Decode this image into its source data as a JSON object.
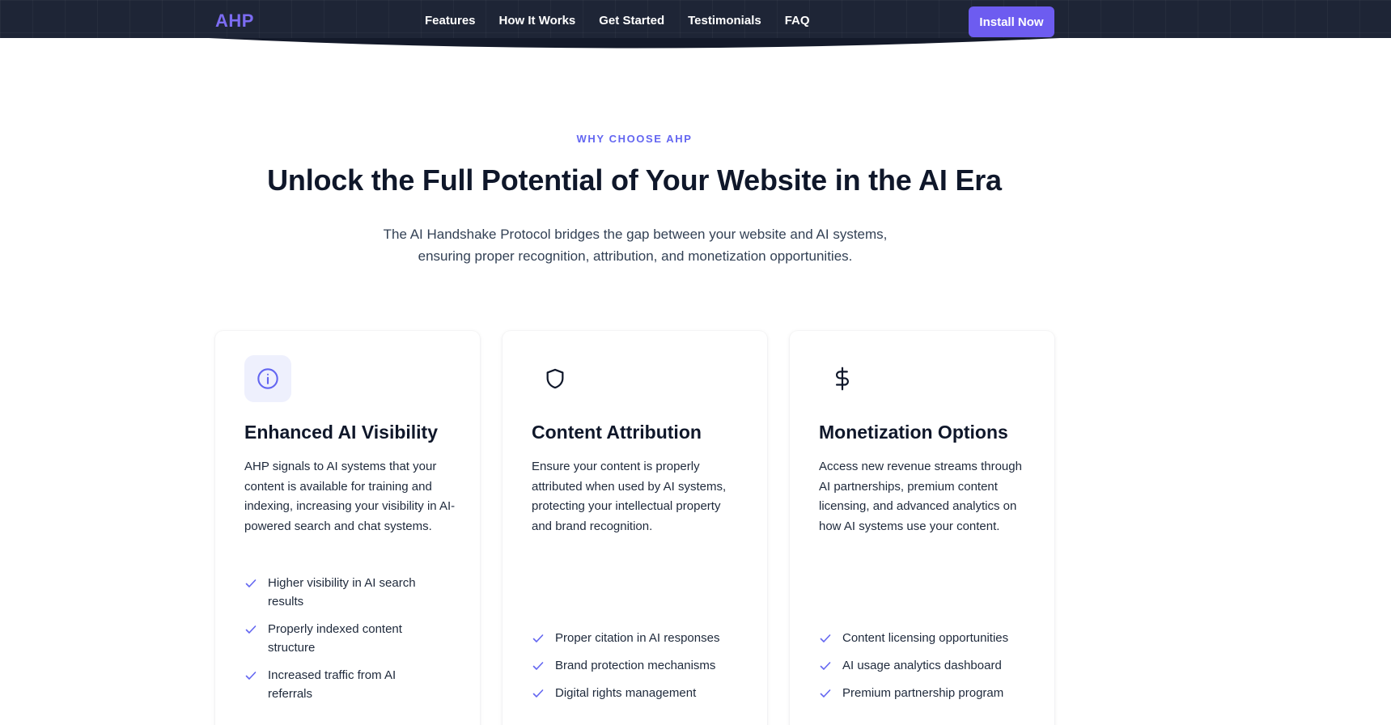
{
  "nav": {
    "logo": "AHP",
    "links": [
      "Features",
      "How It Works",
      "Get Started",
      "Testimonials",
      "FAQ"
    ],
    "cta": "Install Now"
  },
  "hero": {
    "eyebrow": "WHY CHOOSE AHP",
    "headline": "Unlock the Full Potential of Your Website in the AI Era",
    "subtext": "The AI Handshake Protocol bridges the gap between your website and AI systems, ensuring proper recognition, attribution, and monetization opportunities."
  },
  "cards": [
    {
      "icon": "info-icon",
      "title": "Enhanced AI Visibility",
      "description": "AHP signals to AI systems that your content is available for training and indexing, increasing your visibility in AI-powered search and chat systems.",
      "features": [
        "Higher visibility in AI search results",
        "Properly indexed content structure",
        "Increased traffic from AI referrals"
      ]
    },
    {
      "icon": "shield-icon",
      "title": "Content Attribution",
      "description": "Ensure your content is properly attributed when used by AI systems, protecting your intellectual property and brand recognition.",
      "features": [
        "Proper citation in AI responses",
        "Brand protection mechanisms",
        "Digital rights management"
      ]
    },
    {
      "icon": "dollar-icon",
      "title": "Monetization Options",
      "description": "Access new revenue streams through AI partnerships, premium content licensing, and advanced analytics on how AI systems use your content.",
      "features": [
        "Content licensing opportunities",
        "AI usage analytics dashboard",
        "Premium partnership program"
      ]
    }
  ],
  "colors": {
    "accent": "#6366f1",
    "nav_bg": "#1e2536",
    "button": "#6d5cf0",
    "heading": "#0f172a"
  }
}
